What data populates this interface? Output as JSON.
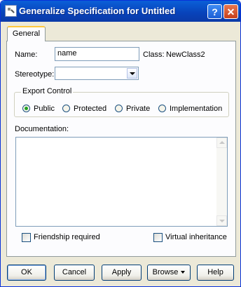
{
  "window": {
    "title": "Generalize Specification for Untitled"
  },
  "titlebar_buttons": {
    "help": "?",
    "close": "✕"
  },
  "tabs": [
    {
      "label": "General"
    }
  ],
  "form": {
    "name_label": "Name:",
    "name_value": "name",
    "class_label": "Class:",
    "class_value": "NewClass2",
    "stereotype_label": "Stereotype:",
    "stereotype_value": "",
    "export_control": {
      "title": "Export Control",
      "options": [
        "Public",
        "Protected",
        "Private",
        "Implementation"
      ],
      "selected": "Public"
    },
    "documentation_label": "Documentation:",
    "documentation_value": "",
    "friendship_label": "Friendship required",
    "friendship_checked": false,
    "virtual_label": "Virtual inheritance",
    "virtual_checked": false
  },
  "buttons": {
    "ok": "OK",
    "cancel": "Cancel",
    "apply": "Apply",
    "browse": "Browse",
    "help": "Help"
  },
  "icons": {
    "app": "pencil-icon",
    "help": "help-icon",
    "close": "close-icon"
  },
  "colors": {
    "titlebar": "#0842b9",
    "face": "#ece9d8",
    "panel": "#fcfcfe",
    "close": "#c6401c",
    "radio_dot": "#21a121"
  }
}
